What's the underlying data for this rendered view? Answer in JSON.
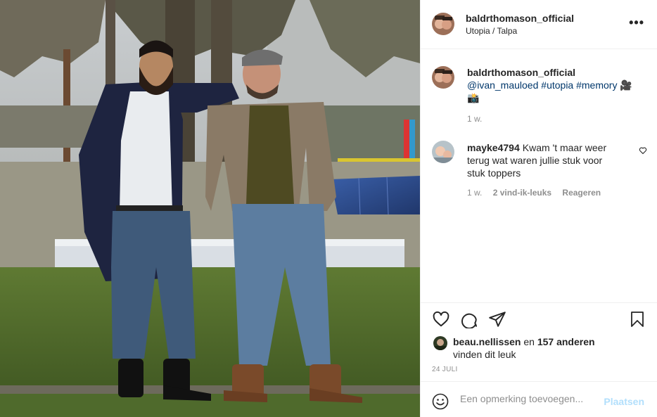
{
  "header": {
    "username": "baldrthomason_official",
    "location": "Utopia / Talpa",
    "more": "•••"
  },
  "caption": {
    "username": "baldrthomason_official",
    "mention": "@ivan_mauloed",
    "tag1": "#utopia",
    "tag2": "#memory",
    "emoji": "🎥📸",
    "time": "1 w."
  },
  "comment": {
    "username": "mayke4794",
    "text": "Kwam 't maar weer terug wat waren jullie stuk voor stuk toppers",
    "time": "1 w.",
    "likes": "2 vind-ik-leuks",
    "reply": "Reageren"
  },
  "likes": {
    "user": "beau.nellissen",
    "and": " en ",
    "others": "157 anderen",
    "suffix": "vinden dit leuk"
  },
  "date": "24 JULI",
  "add_comment": {
    "placeholder": "Een opmerking toevoegen...",
    "post": "Plaatsen"
  },
  "colors": {
    "link": "#00376b",
    "muted": "#8e8e8e",
    "post_button": "#b2dffc",
    "border": "#efefef"
  }
}
